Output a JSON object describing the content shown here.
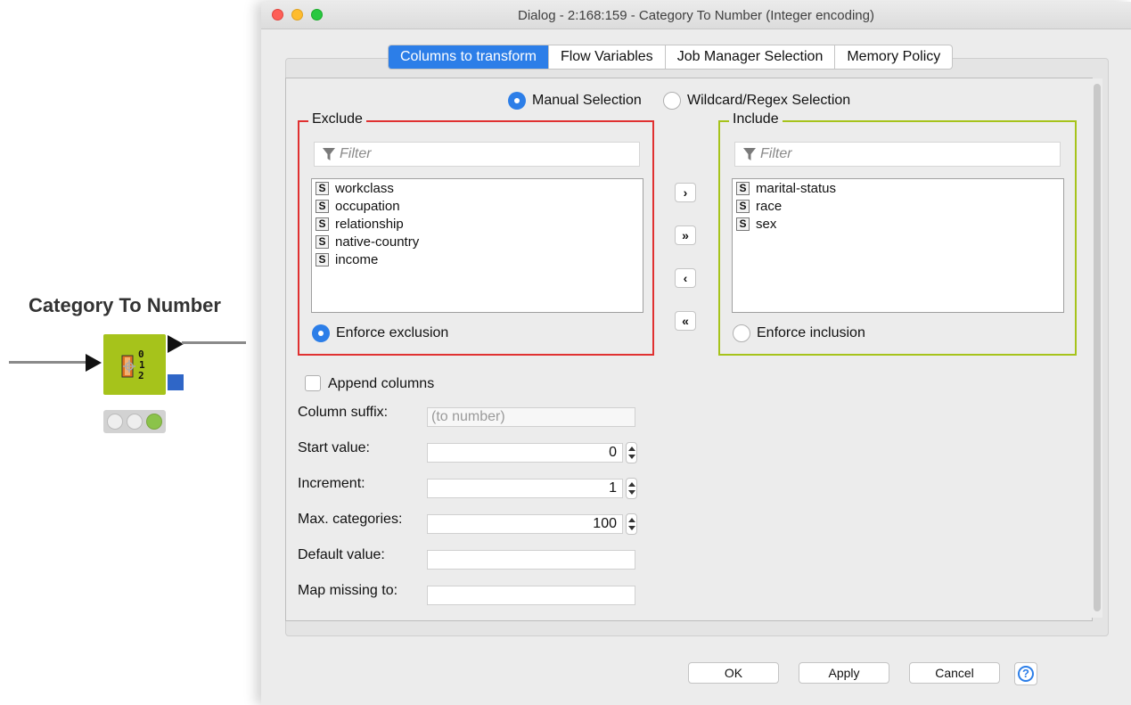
{
  "node": {
    "title": "Category To Number",
    "icon": "category-to-number-icon",
    "color": "#a6c31b",
    "status": "executed",
    "status_lights": [
      "off",
      "off",
      "green"
    ]
  },
  "dialog": {
    "title": "Dialog - 2:168:159 - Category To Number (Integer encoding)",
    "tabs": [
      {
        "label": "Columns to transform",
        "active": true
      },
      {
        "label": "Flow Variables",
        "active": false
      },
      {
        "label": "Job Manager Selection",
        "active": false
      },
      {
        "label": "Memory Policy",
        "active": false
      }
    ],
    "selection_mode": {
      "manual_label": "Manual Selection",
      "wildcard_label": "Wildcard/Regex Selection",
      "selected": "Manual Selection"
    },
    "exclude": {
      "legend": "Exclude",
      "filter_placeholder": "Filter",
      "items": [
        "workclass",
        "occupation",
        "relationship",
        "native-country",
        "income"
      ],
      "enforce_label": "Enforce exclusion",
      "enforce_selected": true,
      "border_color": "#e03131"
    },
    "include": {
      "legend": "Include",
      "filter_placeholder": "Filter",
      "items": [
        "marital-status",
        "race",
        "sex"
      ],
      "enforce_label": "Enforce inclusion",
      "enforce_selected": false,
      "border_color": "#a6c31b"
    },
    "item_type_badge": "S",
    "move_buttons": {
      "add": "›",
      "add_all": "»",
      "remove": "‹",
      "remove_all": "«"
    },
    "append_columns": {
      "label": "Append columns",
      "checked": false
    },
    "fields": {
      "column_suffix": {
        "label": "Column suffix:",
        "value": "",
        "placeholder": "(to number)"
      },
      "start_value": {
        "label": "Start value:",
        "value": "0"
      },
      "increment": {
        "label": "Increment:",
        "value": "1"
      },
      "max_categories": {
        "label": "Max. categories:",
        "value": "100"
      },
      "default_value": {
        "label": "Default value:",
        "value": ""
      },
      "map_missing_to": {
        "label": "Map missing to:",
        "value": ""
      }
    },
    "buttons": {
      "ok": "OK",
      "apply": "Apply",
      "cancel": "Cancel",
      "help": "?"
    },
    "accent_color": "#2c7ee8"
  }
}
